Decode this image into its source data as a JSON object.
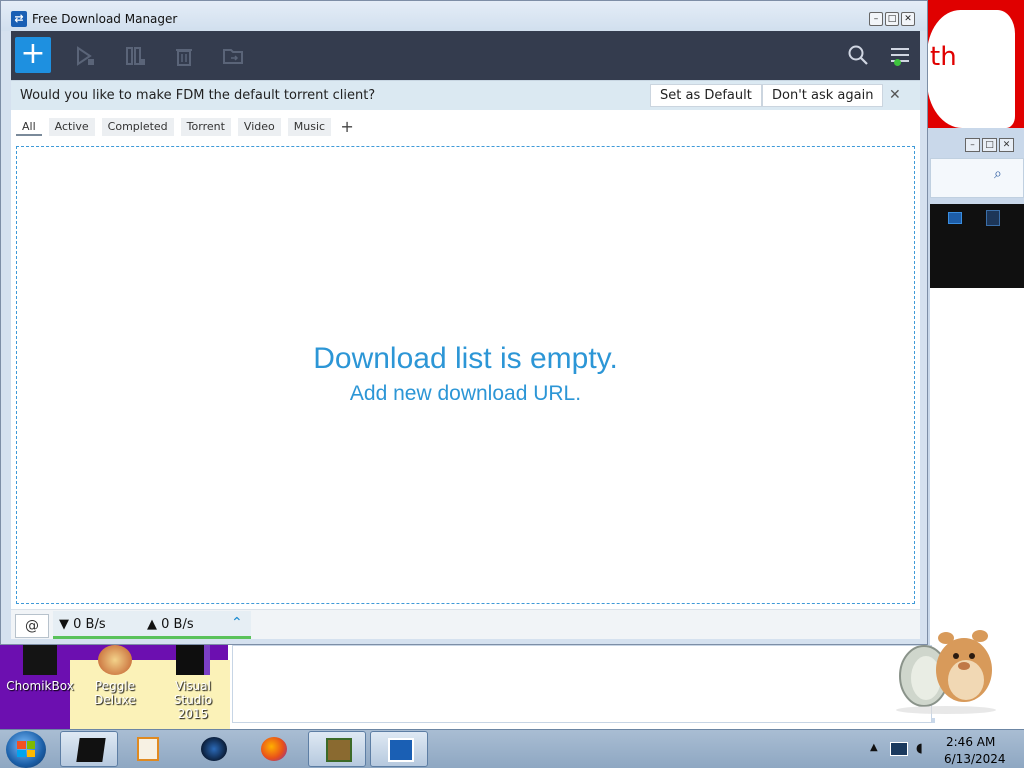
{
  "window": {
    "title": "Free Download Manager",
    "controls": {
      "minimize": "–",
      "maximize": "□",
      "close": "✕"
    }
  },
  "toolbar": {
    "add_label": "+",
    "icons": [
      "add-download-icon",
      "play-icon",
      "pause-icon",
      "trash-icon",
      "folder-icon",
      "search-icon",
      "hamburger-menu-icon"
    ],
    "accent_color": "#1e90e0",
    "status_dot_color": "#3ec43e"
  },
  "notification": {
    "message": "Would you like to make FDM the default torrent client?",
    "set_default_label": "Set as Default",
    "dont_ask_label": "Don't ask again",
    "close_label": "✕"
  },
  "filters": {
    "tabs": [
      "All",
      "Active",
      "Completed",
      "Torrent",
      "Video",
      "Music"
    ],
    "selected": "All",
    "add_label": "+"
  },
  "empty_state": {
    "title": "Download list is empty.",
    "link": "Add new download URL.",
    "color": "#2c96d6"
  },
  "status": {
    "down_speed": "▼ 0 B/s",
    "up_speed": "▲ 0 B/s",
    "expand_label": "⌃"
  },
  "desktop": {
    "banner_text": "th",
    "icons": [
      {
        "label": "ChomikBox"
      },
      {
        "label": "Peggle Deluxe"
      },
      {
        "label": "Visual Studio 2015"
      }
    ]
  },
  "taskbar": {
    "time": "2:46 AM",
    "date": "6/13/2024",
    "buttons": [
      "ChomikBox",
      "Media Player",
      "Steam",
      "Firefox",
      "Box",
      "Free Download Manager"
    ]
  }
}
